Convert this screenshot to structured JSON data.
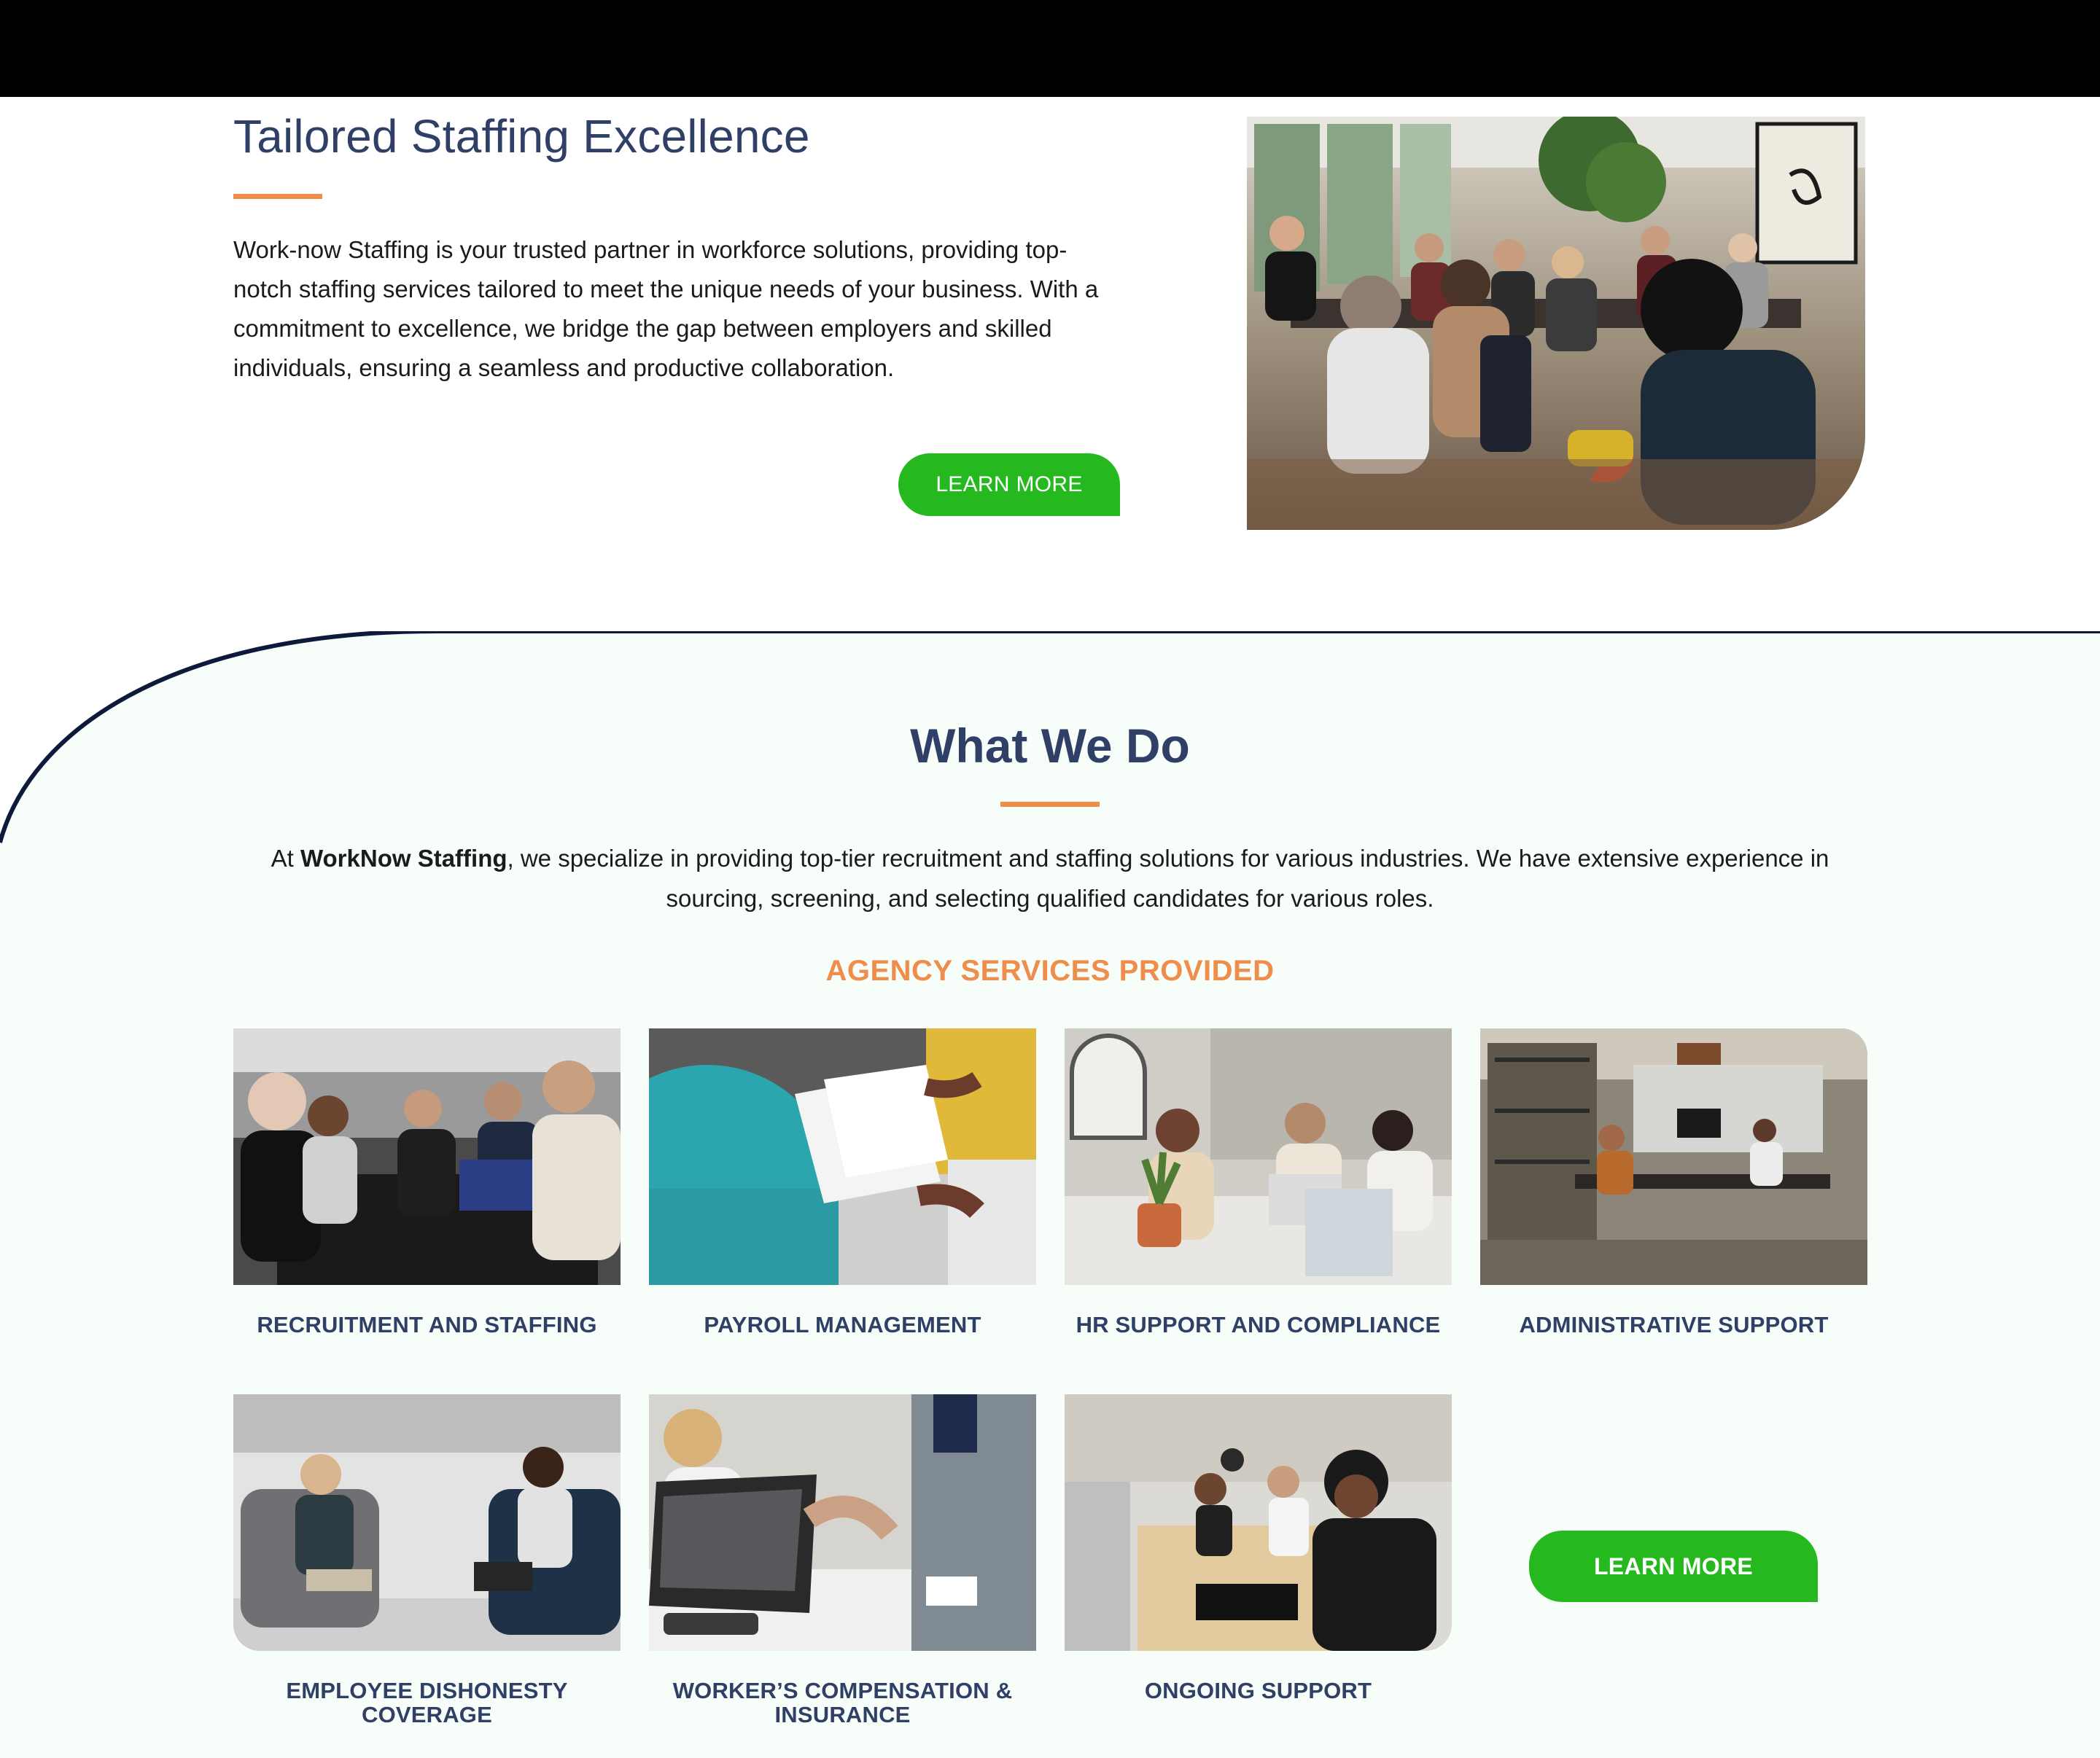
{
  "section1": {
    "title": "Tailored Staffing Excellence",
    "paragraph": "Work-now Staffing is your trusted partner in workforce solutions, providing top-notch staffing services tailored to meet the unique needs of your business. With a commitment to excellence, we bridge the gap between employers and skilled individuals, ensuring a seamless and productive collaboration.",
    "button_label": "LEARN MORE"
  },
  "section2": {
    "title": "What We Do",
    "intro_prefix": "At ",
    "intro_brand": "WorkNow Staffing",
    "intro_rest": ", we specialize in providing top-tier recruitment and staffing solutions for various industries. We have extensive experience in sourcing, screening, and selecting qualified candidates for various roles.",
    "subtitle": "AGENCY SERVICES PROVIDED",
    "services": [
      {
        "label": "RECRUITMENT AND STAFFING"
      },
      {
        "label": "PAYROLL MANAGEMENT"
      },
      {
        "label": "HR SUPPORT AND COMPLIANCE"
      },
      {
        "label": "ADMINISTRATIVE SUPPORT"
      },
      {
        "label": "EMPLOYEE DISHONESTY COVERAGE"
      },
      {
        "label": "WORKER’S COMPENSATION & INSURANCE"
      },
      {
        "label": "ONGOING SUPPORT"
      }
    ],
    "button_label": "LEARN MORE"
  },
  "colors": {
    "heading": "#2f3f66",
    "accent_orange": "#ef8d4b",
    "button_green": "#25b91f",
    "section_bg": "#f7fdf9",
    "curve_navy": "#0e1a3c"
  }
}
